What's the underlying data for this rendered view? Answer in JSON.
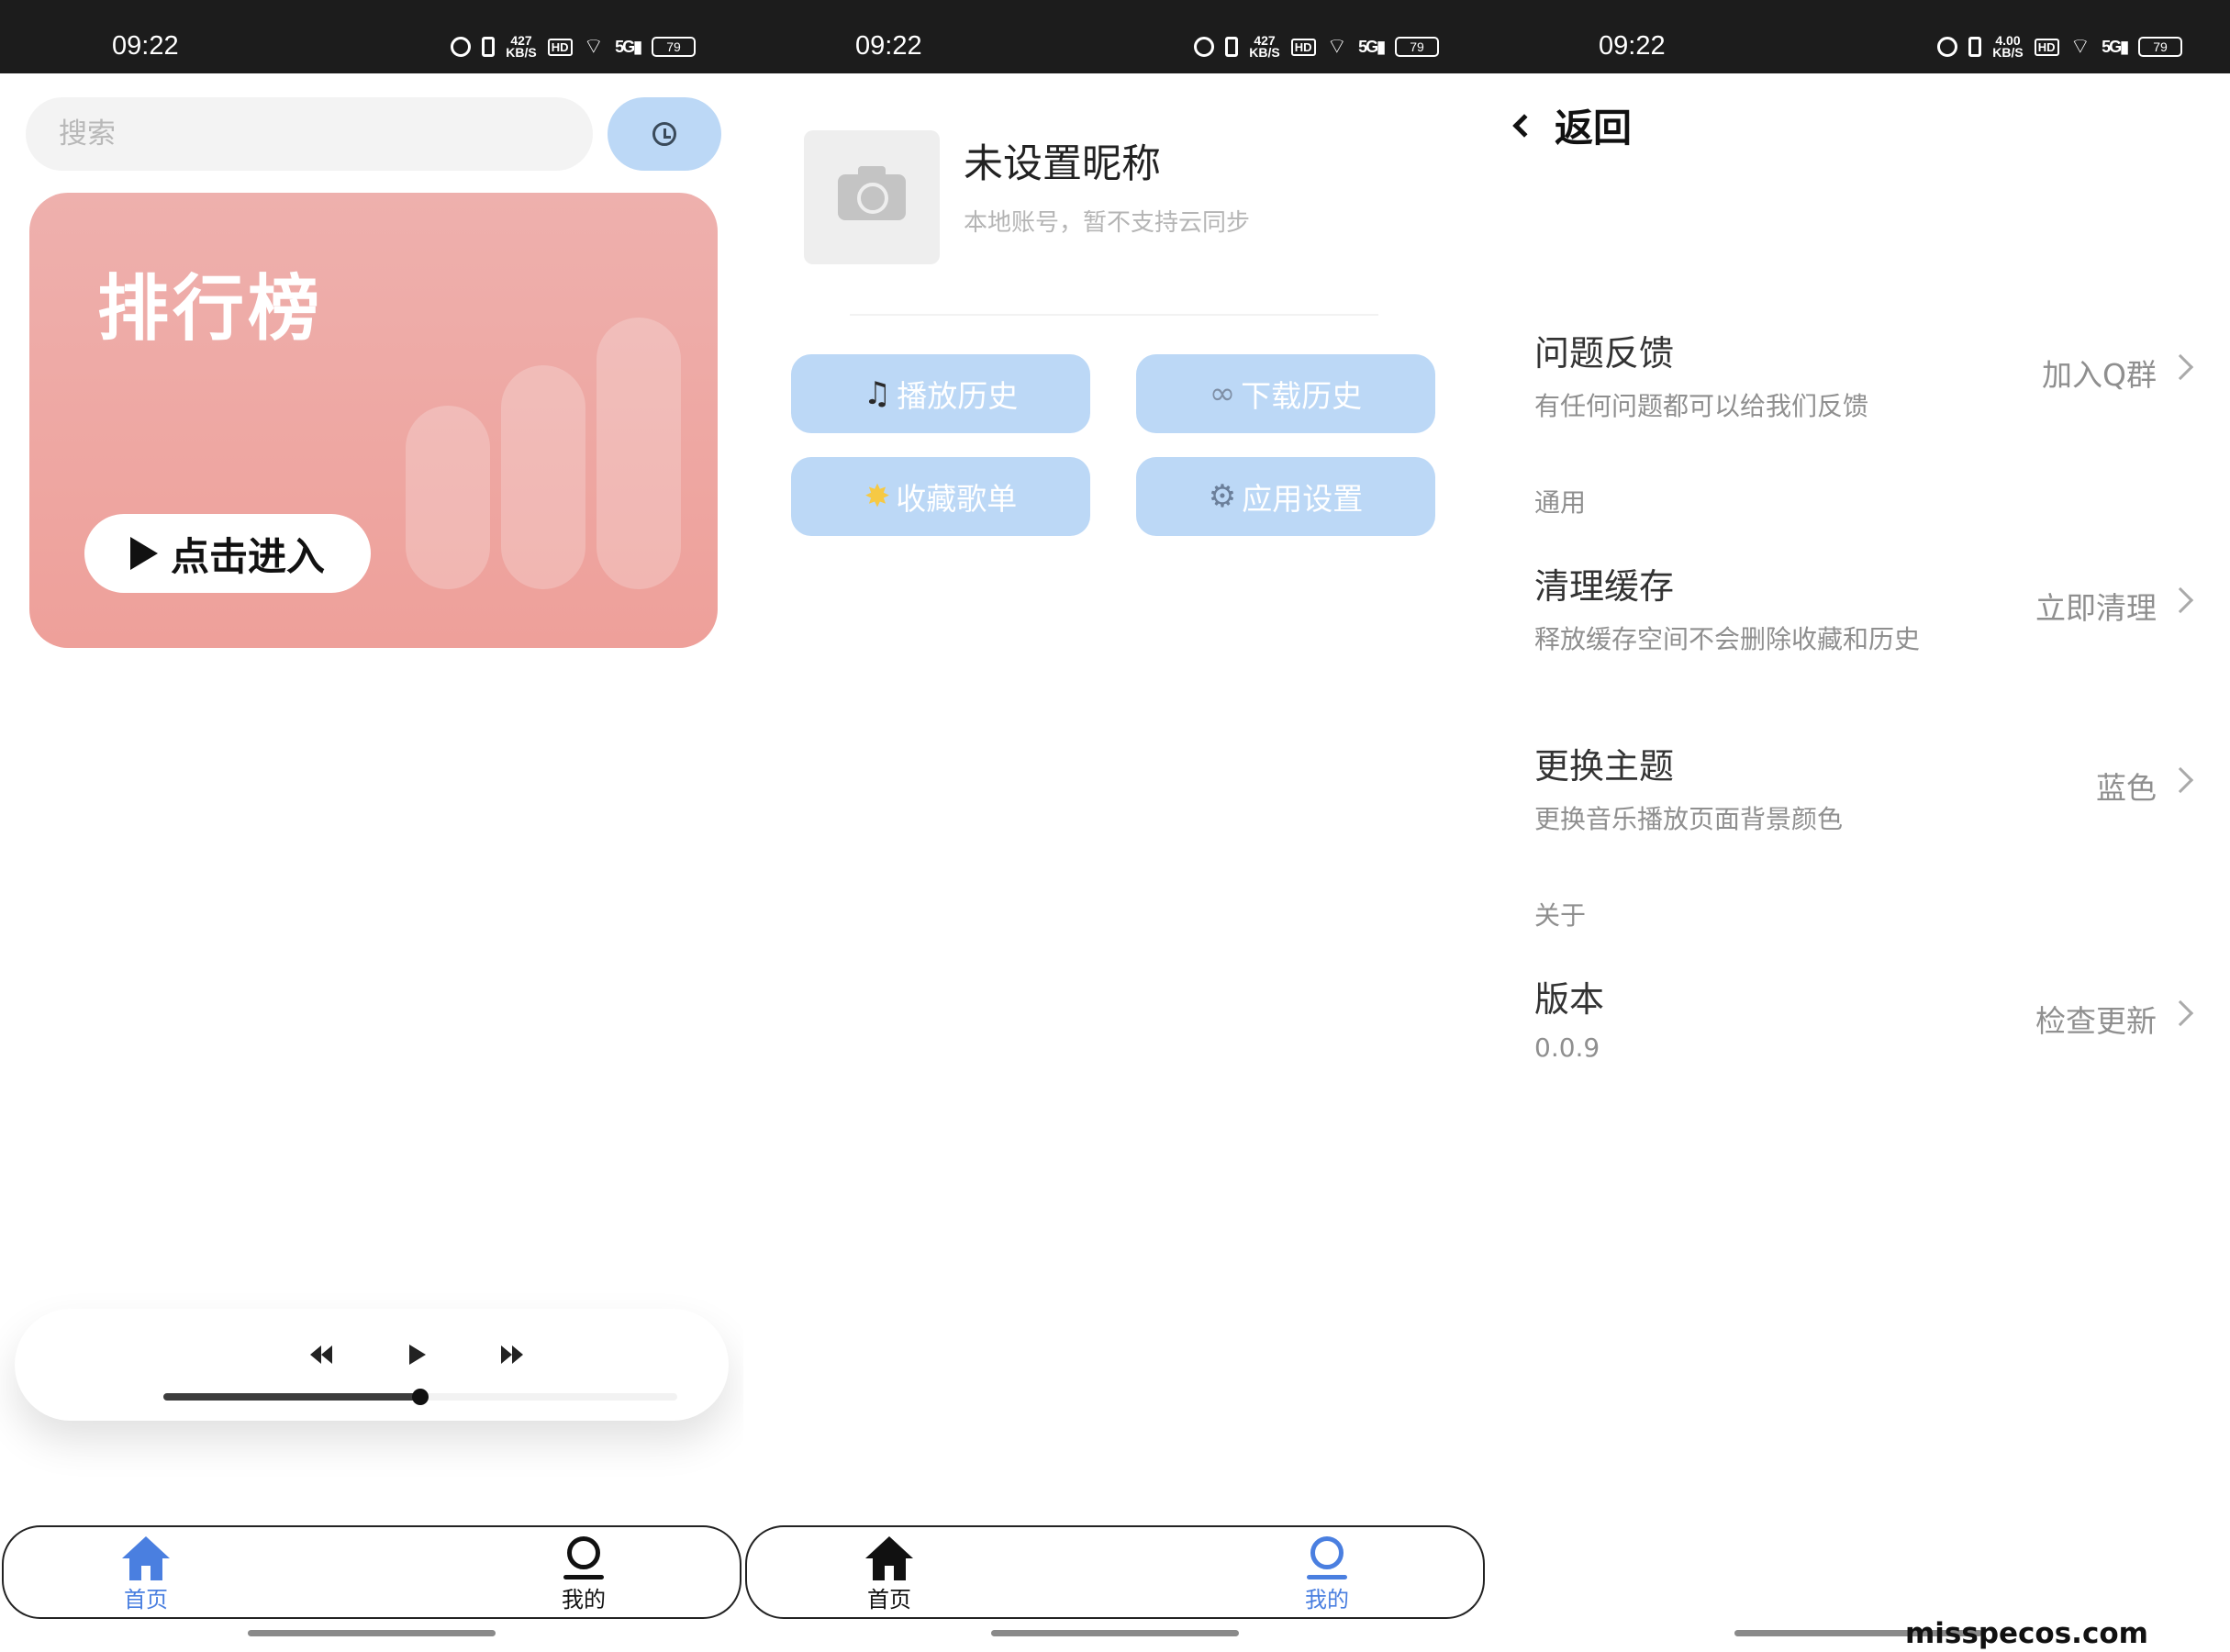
{
  "status_bar": {
    "time": "09:22",
    "net_speed_1": "427",
    "net_speed_2": "427",
    "net_speed_3": "4.00",
    "net_unit": "KB/S",
    "hd": "HD",
    "signal": "5G",
    "battery": "79"
  },
  "home": {
    "search_placeholder": "搜索",
    "history_icon": "history-icon",
    "rank_card": {
      "title": "排行榜",
      "enter_label": "点击进入",
      "gradient_top": "#eeb0ad",
      "gradient_bottom": "#eea09a"
    },
    "player": {
      "progress": 0.5
    }
  },
  "nav": {
    "home_label": "首页",
    "mine_label": "我的",
    "active_color": "#4a7fe0"
  },
  "mine": {
    "nickname": "未设置昵称",
    "account_note": "本地账号，暂不支持云同步",
    "buttons": {
      "play_history": "播放历史",
      "download_history": "下载历史",
      "favorites": "收藏歌单",
      "app_settings": "应用设置"
    },
    "button_color": "#bcd8f6"
  },
  "settings": {
    "back_label": "返回",
    "feedback": {
      "title": "问题反馈",
      "subtitle": "有任何问题都可以给我们反馈",
      "action": "加入Q群"
    },
    "section_general": "通用",
    "clear_cache": {
      "title": "清理缓存",
      "subtitle": "释放缓存空间不会删除收藏和历史",
      "action": "立即清理"
    },
    "theme": {
      "title": "更换主题",
      "subtitle": "更换音乐播放页面背景颜色",
      "action": "蓝色"
    },
    "section_about": "关于",
    "version": {
      "title": "版本",
      "subtitle": "0.0.9",
      "action": "检查更新"
    }
  },
  "watermark": "misspecos.com"
}
